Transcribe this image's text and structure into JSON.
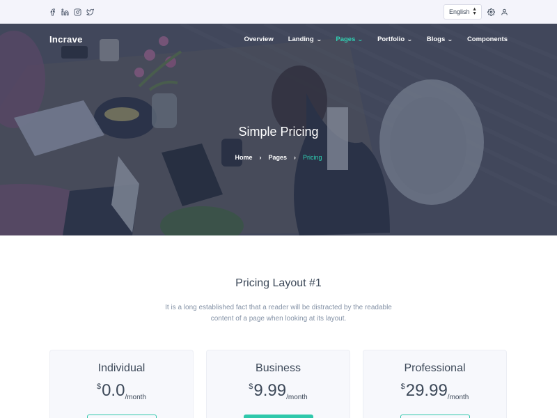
{
  "topbar": {
    "social_icons": [
      "facebook-icon",
      "linkedin-icon",
      "instagram-icon",
      "twitter-icon"
    ],
    "language": "English",
    "settings_icon": "gear-icon",
    "account_icon": "user-icon"
  },
  "nav": {
    "brand": "Incrave",
    "items": [
      {
        "label": "Overview",
        "dropdown": false,
        "active": false
      },
      {
        "label": "Landing",
        "dropdown": true,
        "active": false
      },
      {
        "label": "Pages",
        "dropdown": true,
        "active": true
      },
      {
        "label": "Portfolio",
        "dropdown": true,
        "active": false
      },
      {
        "label": "Blogs",
        "dropdown": true,
        "active": false
      },
      {
        "label": "Components",
        "dropdown": false,
        "active": false
      }
    ]
  },
  "hero": {
    "title": "Simple Pricing",
    "breadcrumb": [
      "Home",
      "Pages",
      "Pricing"
    ]
  },
  "pricing": {
    "title": "Pricing Layout #1",
    "description": "It is a long established fact that a reader will be distracted by the readable content of a page when looking at its layout.",
    "plans": [
      {
        "name": "Individual",
        "currency": "$",
        "amount": "0.0",
        "period": "/month"
      },
      {
        "name": "Business",
        "currency": "$",
        "amount": "9.99",
        "period": "/month"
      },
      {
        "name": "Professional",
        "currency": "$",
        "amount": "29.99",
        "period": "/month"
      }
    ]
  },
  "colors": {
    "accent": "#2fd0b3",
    "topbar_bg": "#f4f4fb",
    "text_dark": "#3c4858",
    "text_muted": "#8492a6"
  }
}
